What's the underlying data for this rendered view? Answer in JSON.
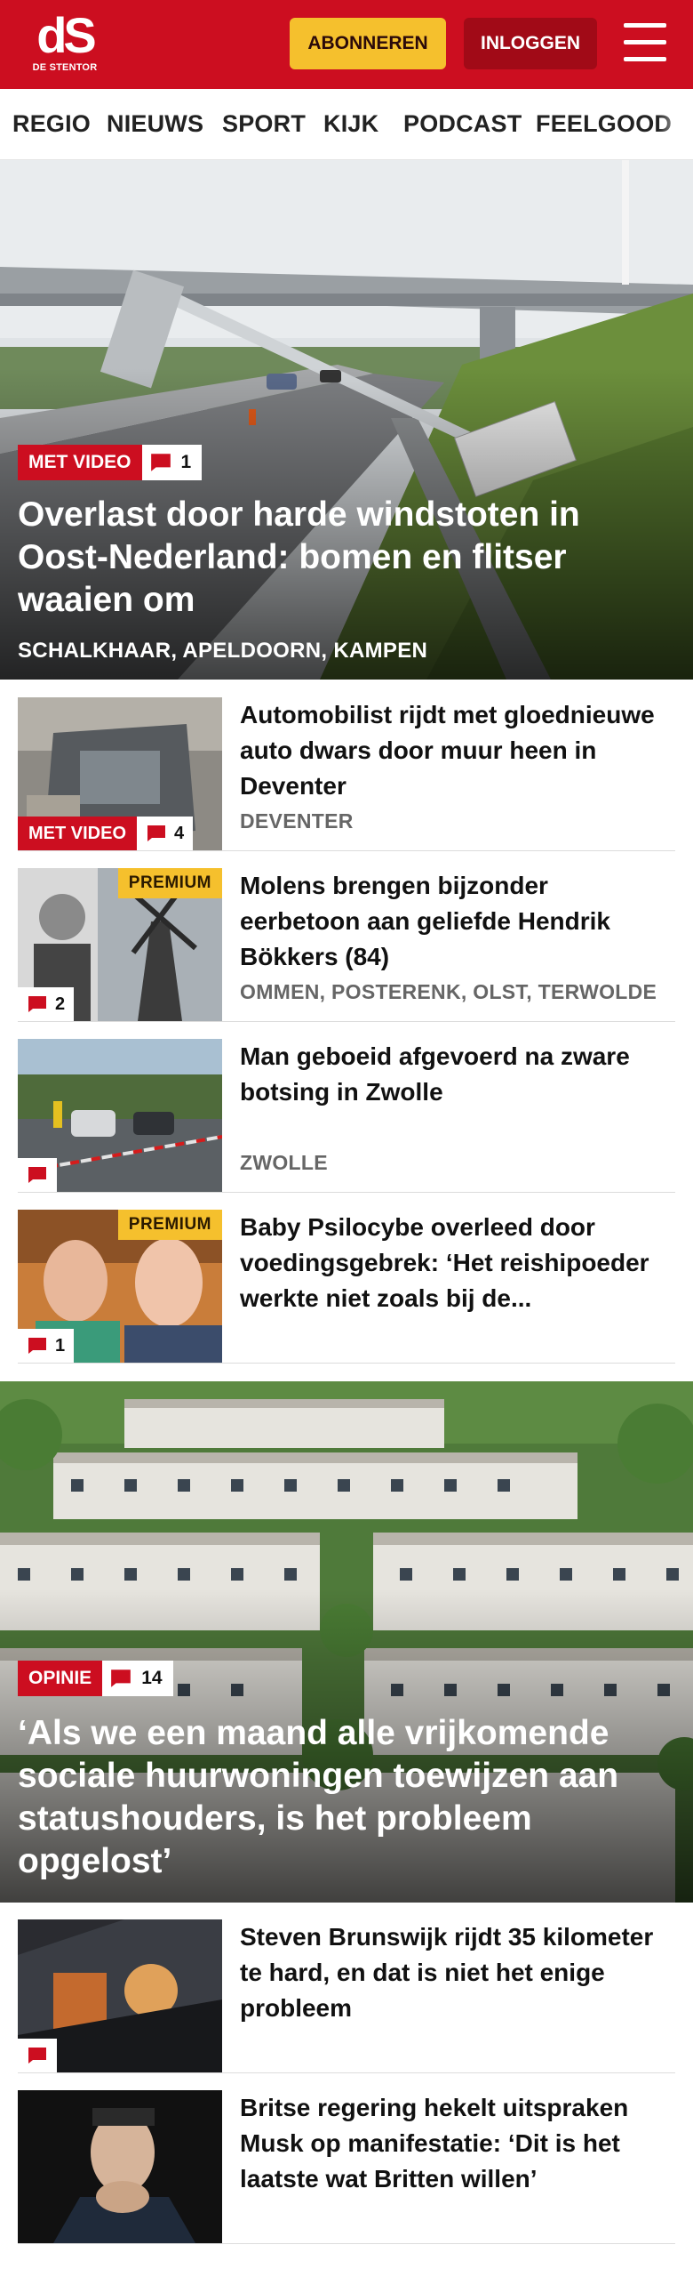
{
  "header": {
    "logo_text": "dS",
    "logo_sub": "DE STENTOR",
    "subscribe_label": "ABONNEREN",
    "login_label": "INLOGGEN",
    "brand_color": "#cc0e20",
    "accent_color": "#f5c02d"
  },
  "nav": {
    "items": [
      {
        "label": "REGIO"
      },
      {
        "label": "NIEUWS"
      },
      {
        "label": "SPORT"
      },
      {
        "label": "KIJK"
      },
      {
        "label": "PODCAST"
      },
      {
        "label": "FEELGOOD"
      }
    ]
  },
  "hero1": {
    "tag": "MET VIDEO",
    "comments": "1",
    "title": "Overlast door harde windstoten in Oost-Nederland: bomen en flitser waaien om",
    "location": "SCHALKHAAR, APELDOORN, KAMPEN"
  },
  "articles": [
    {
      "title": "Automobilist rijdt met gloednieuwe auto dwars door muur heen in Deventer",
      "location": "DEVENTER",
      "tag": "MET VIDEO",
      "comments": "4"
    },
    {
      "title": "Molens brengen bijzonder eerbetoon aan geliefde Hendrik Bökkers (84)",
      "location": "OMMEN, POSTERENK, OLST, TERWOLDE",
      "premium": "PREMIUM",
      "comments": "2"
    },
    {
      "title": "Man geboeid afgevoerd na zware botsing in Zwolle",
      "location": "ZWOLLE"
    },
    {
      "title": "Baby Psilocybe overleed door voedingsgebrek: ‘Het reishipoe­der werkte niet zoals bij de...",
      "premium": "PREMIUM",
      "comments": "1"
    }
  ],
  "hero2": {
    "tag": "OPINIE",
    "comments": "14",
    "title": "‘Als we een maand alle vrijkomende sociale huurwoningen toewijzen aan statushouders, is het probleem opgelost’"
  },
  "articles2": [
    {
      "title": "Steven Brunswijk rijdt 35 kilometer te hard, en dat is niet het enige probleem"
    },
    {
      "title": "Britse regering hekelt uitspraken Musk op manifestatie: ‘Dit is het laatste wat Britten willen’"
    }
  ]
}
